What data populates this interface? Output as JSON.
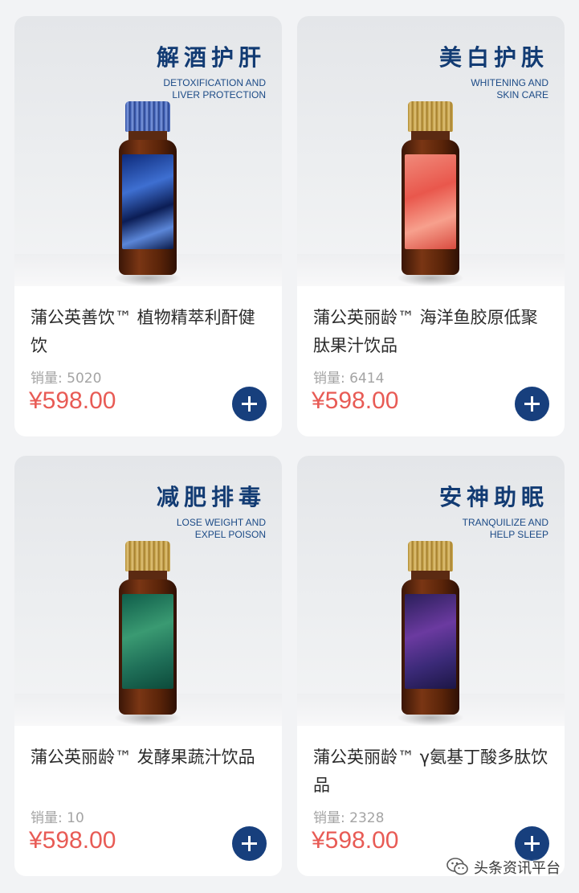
{
  "products": [
    {
      "hero_title": "解酒护肝",
      "hero_subtitle": "DETOXIFICATION AND\nLIVER PROTECTION",
      "name": "蒲公英善饮™ 植物精萃利酐健饮",
      "sales": "销量: 5020",
      "price": "¥598.00",
      "bottle_style": "blue"
    },
    {
      "hero_title": "美白护肤",
      "hero_subtitle": "WHITENING AND\nSKIN CARE",
      "name": "蒲公英丽龄™ 海洋鱼胶原低聚肽果汁饮品",
      "sales": "销量: 6414",
      "price": "¥598.00",
      "bottle_style": "pink"
    },
    {
      "hero_title": "减肥排毒",
      "hero_subtitle": "LOSE WEIGHT AND\nEXPEL POISON",
      "name": "蒲公英丽龄™ 发酵果蔬汁饮品",
      "sales": "销量: 10",
      "price": "¥598.00",
      "bottle_style": "green"
    },
    {
      "hero_title": "安神助眠",
      "hero_subtitle": "TRANQUILIZE AND\nHELP SLEEP",
      "name": "蒲公英丽龄™ γ氨基丁酸多肽饮品",
      "sales": "销量: 2328",
      "price": "¥598.00",
      "bottle_style": "purple"
    }
  ],
  "add_button_icon": "plus-icon",
  "watermark": {
    "text": "头条资讯平台",
    "icon": "wechat-icon"
  },
  "colors": {
    "title_blue": "#123b73",
    "price_red": "#e85b55",
    "button_navy": "#173f7d"
  }
}
